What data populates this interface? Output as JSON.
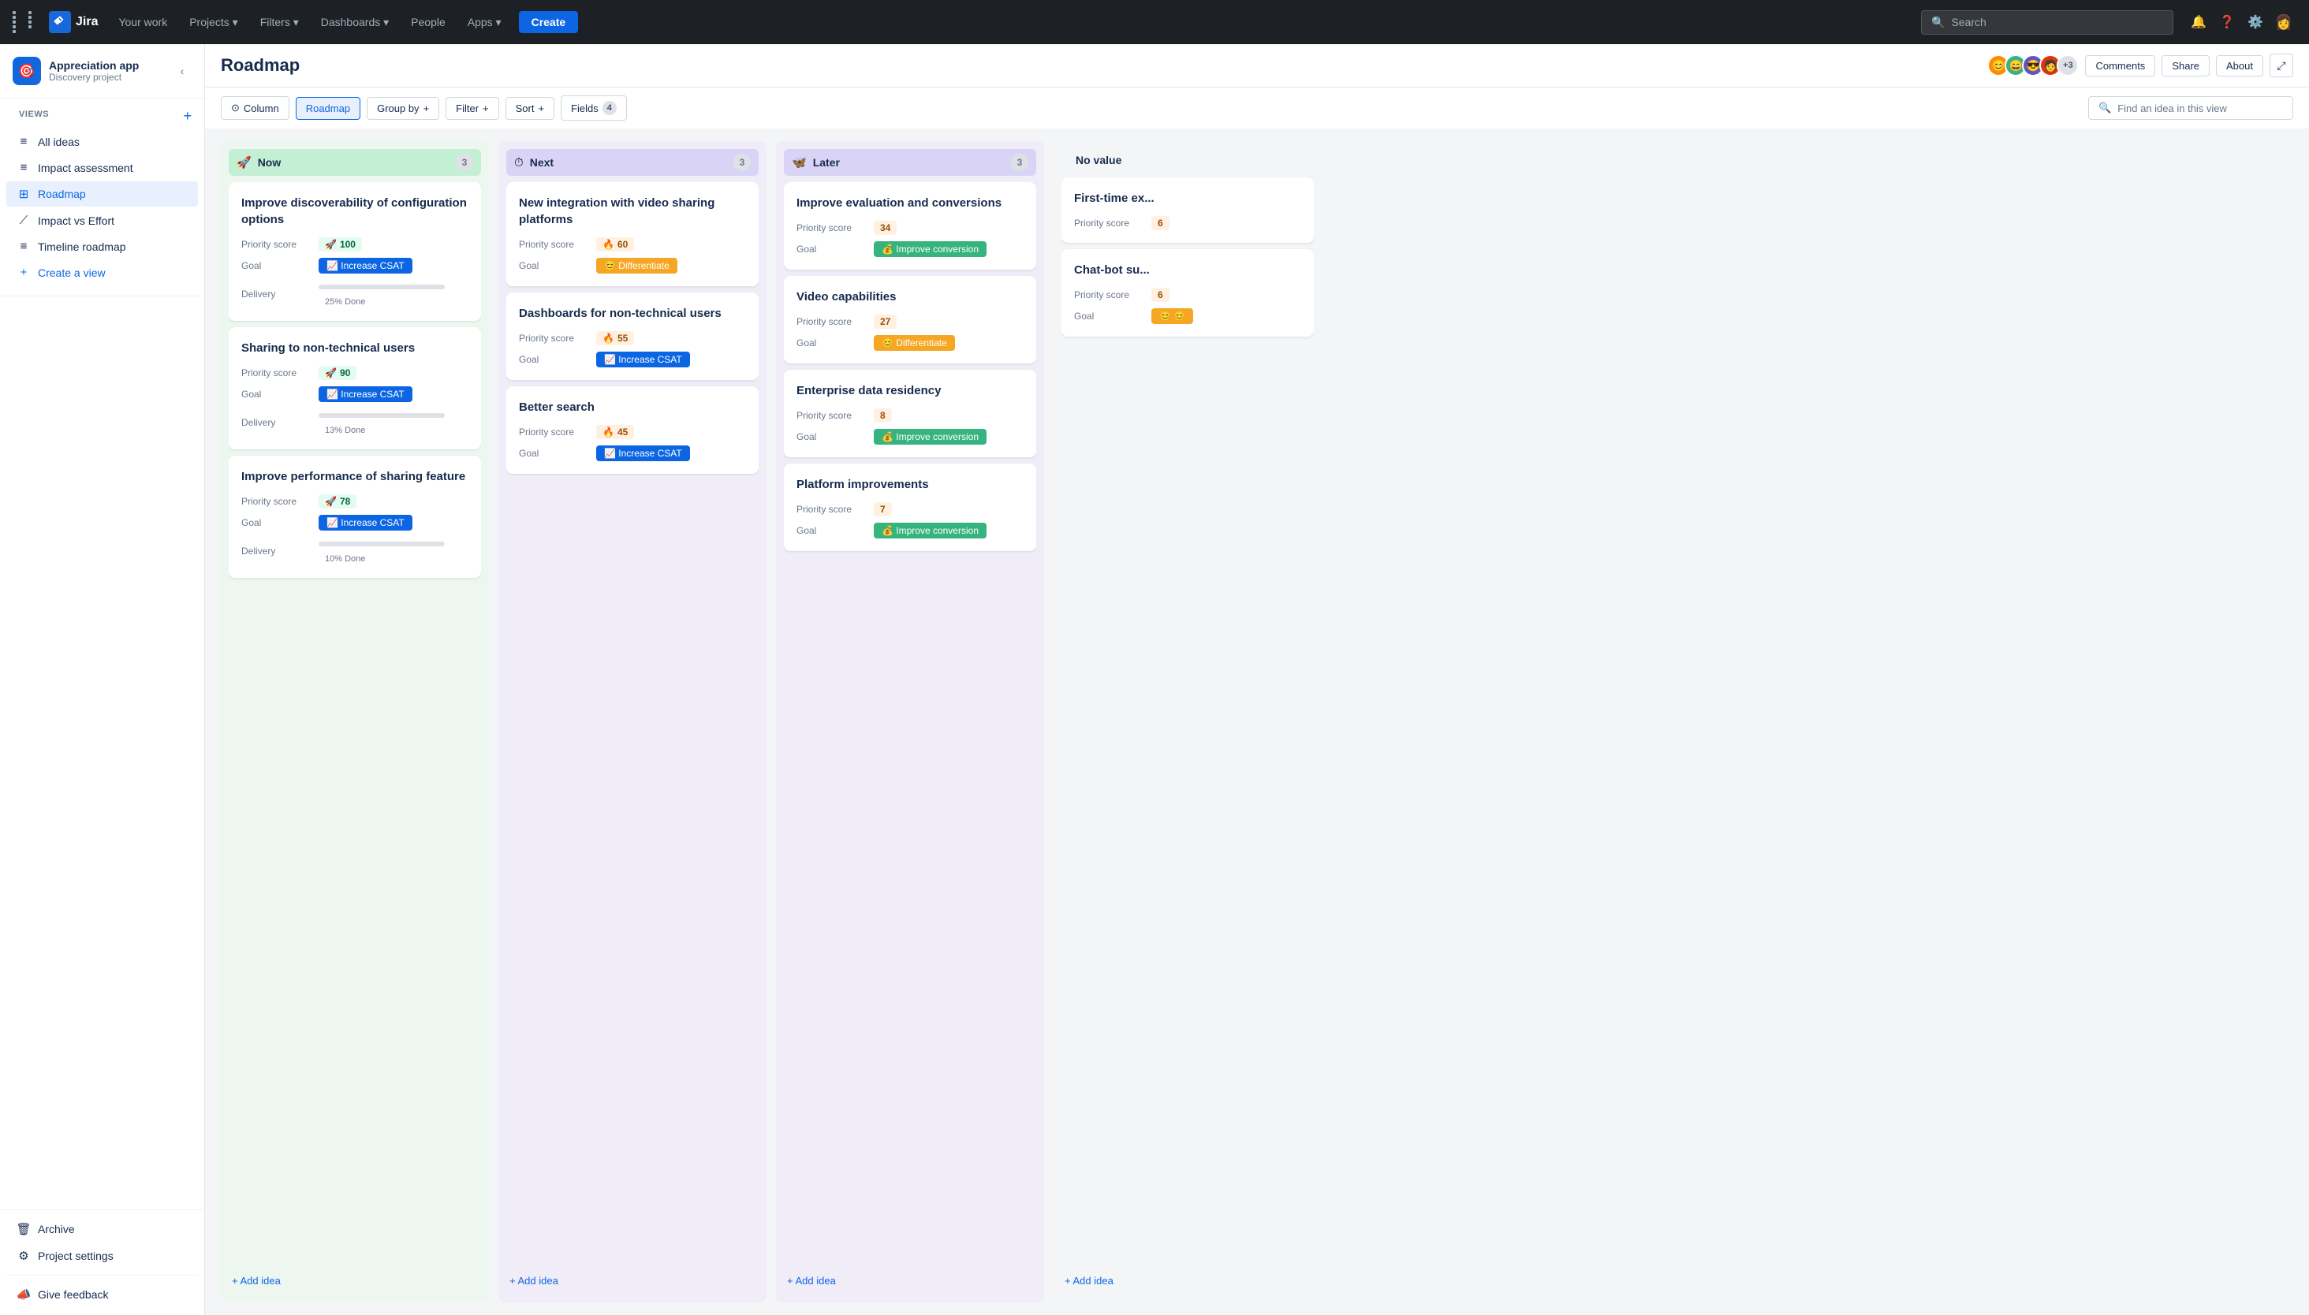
{
  "topnav": {
    "logo_text": "Jira",
    "nav_items": [
      {
        "label": "Your work",
        "has_dropdown": false
      },
      {
        "label": "Projects",
        "has_dropdown": true
      },
      {
        "label": "Filters",
        "has_dropdown": true
      },
      {
        "label": "Dashboards",
        "has_dropdown": true
      },
      {
        "label": "People",
        "has_dropdown": false
      },
      {
        "label": "Apps",
        "has_dropdown": true
      }
    ],
    "create_label": "Create",
    "search_placeholder": "Search"
  },
  "sidebar": {
    "project_name": "Appreciation app",
    "project_type": "Discovery project",
    "views_label": "VIEWS",
    "add_view_label": "+",
    "nav_items": [
      {
        "label": "All ideas",
        "icon": "≡",
        "active": false
      },
      {
        "label": "Impact assessment",
        "icon": "≡",
        "active": false
      },
      {
        "label": "Roadmap",
        "icon": "⊞",
        "active": true
      },
      {
        "label": "Impact vs Effort",
        "icon": "⟋",
        "active": false
      },
      {
        "label": "Timeline roadmap",
        "icon": "≡",
        "active": false
      }
    ],
    "create_view_label": "Create a view",
    "archive_label": "Archive",
    "settings_label": "Project settings",
    "feedback_label": "Give feedback"
  },
  "page": {
    "title": "Roadmap",
    "header_btns": [
      "Comments",
      "Share",
      "About"
    ],
    "toolbar": {
      "column_label": "Column",
      "roadmap_label": "Roadmap",
      "groupby_label": "Group by",
      "filter_label": "Filter",
      "sort_label": "Sort",
      "fields_label": "Fields",
      "fields_count": "4",
      "search_placeholder": "Find an idea in this view"
    }
  },
  "columns": [
    {
      "id": "now",
      "title": "Now",
      "emoji": "🚀",
      "count": 3,
      "bg": "now",
      "cards": [
        {
          "title": "Improve discoverability of configuration options",
          "priority_score": "100",
          "score_type": "green",
          "score_emoji": "🚀",
          "goal": "Increase CSAT",
          "goal_type": "blue",
          "goal_emoji": "📈",
          "has_delivery": true,
          "delivery_pct": 25,
          "delivery_label": "25% Done"
        },
        {
          "title": "Sharing to non-technical users",
          "priority_score": "90",
          "score_type": "green",
          "score_emoji": "🚀",
          "goal": "Increase CSAT",
          "goal_type": "blue",
          "goal_emoji": "📈",
          "has_delivery": true,
          "delivery_pct": 13,
          "delivery_label": "13% Done"
        },
        {
          "title": "Improve performance of sharing feature",
          "priority_score": "78",
          "score_type": "green",
          "score_emoji": "🚀",
          "goal": "Increase CSAT",
          "goal_type": "blue",
          "goal_emoji": "📈",
          "has_delivery": true,
          "delivery_pct": 10,
          "delivery_label": "10% Done"
        }
      ]
    },
    {
      "id": "next",
      "title": "Next",
      "emoji": "⏱",
      "count": 3,
      "bg": "next",
      "cards": [
        {
          "title": "New integration with video sharing platforms",
          "priority_score": "60",
          "score_type": "orange",
          "score_emoji": "🔥",
          "goal": "Differentiate",
          "goal_type": "yellow",
          "goal_emoji": "😊",
          "has_delivery": false
        },
        {
          "title": "Dashboards for non-technical users",
          "priority_score": "55",
          "score_type": "orange",
          "score_emoji": "🔥",
          "goal": "Increase CSAT",
          "goal_type": "blue",
          "goal_emoji": "📈",
          "has_delivery": false
        },
        {
          "title": "Better search",
          "priority_score": "45",
          "score_type": "orange",
          "score_emoji": "🔥",
          "goal": "Increase CSAT",
          "goal_type": "blue",
          "goal_emoji": "📈",
          "has_delivery": false
        }
      ]
    },
    {
      "id": "later",
      "title": "Later",
      "emoji": "🦋",
      "count": 3,
      "bg": "later",
      "cards": [
        {
          "title": "Improve evaluation and conversions",
          "priority_score": "34",
          "score_type": "orange",
          "score_emoji": null,
          "goal": "Improve conversion",
          "goal_type": "green",
          "goal_emoji": "💰",
          "has_delivery": false
        },
        {
          "title": "Video capabilities",
          "priority_score": "27",
          "score_type": "orange",
          "score_emoji": null,
          "goal": "Differentiate",
          "goal_type": "yellow",
          "goal_emoji": "😊",
          "has_delivery": false
        },
        {
          "title": "Enterprise data residency",
          "priority_score": "8",
          "score_type": "orange",
          "score_emoji": null,
          "goal": "Improve conversion",
          "goal_type": "green",
          "goal_emoji": "💰",
          "has_delivery": false
        },
        {
          "title": "Platform improvements",
          "priority_score": "7",
          "score_type": "orange",
          "score_emoji": null,
          "goal": "Improve conversion",
          "goal_type": "green",
          "goal_emoji": "💰",
          "has_delivery": false
        }
      ]
    },
    {
      "id": "noval",
      "title": "No value",
      "emoji": "",
      "count": null,
      "bg": "noval",
      "cards": [
        {
          "title": "First-time ex...",
          "priority_score": "6",
          "score_type": "orange",
          "score_emoji": null,
          "goal": null,
          "goal_type": null,
          "goal_emoji": null,
          "has_delivery": false
        },
        {
          "title": "Chat-bot su...",
          "priority_score": "6",
          "score_type": "orange",
          "score_emoji": null,
          "goal": "😊",
          "goal_type": "yellow",
          "goal_emoji": "😊",
          "has_delivery": false
        }
      ]
    }
  ],
  "labels": {
    "priority_score": "Priority score",
    "goal": "Goal",
    "delivery": "Delivery",
    "add_idea": "+ Add idea"
  }
}
